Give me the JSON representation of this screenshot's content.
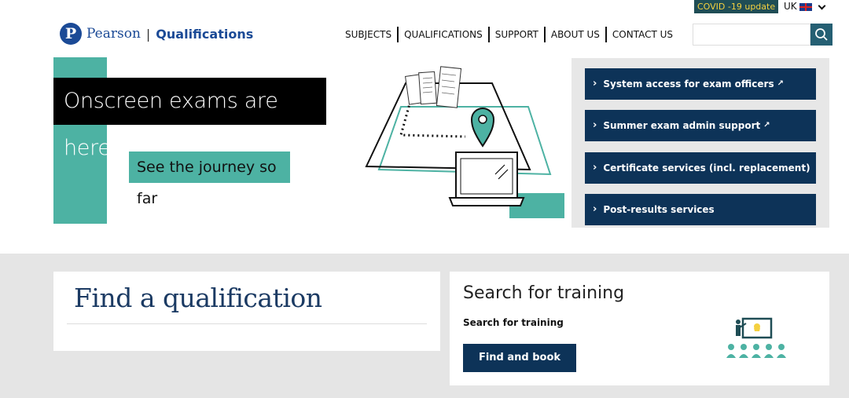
{
  "topbar": {
    "covid_label": "COVID -19 update",
    "locale_label": "UK"
  },
  "header": {
    "logo_brand": "Pearson",
    "logo_separator": "|",
    "logo_sub": "Qualifications",
    "nav": [
      "SUBJECTS",
      "QUALIFICATIONS",
      "SUPPORT",
      "ABOUT US",
      "CONTACT US"
    ],
    "search_placeholder": ""
  },
  "hero": {
    "title": "Onscreen exams are here...",
    "cta": "See the journey so far"
  },
  "quick_links": [
    {
      "label": "System access for exam officers",
      "external": true
    },
    {
      "label": "Summer exam admin support",
      "external": true
    },
    {
      "label": "Certificate services (incl. replacement)",
      "external": false
    },
    {
      "label": "Post-results services",
      "external": false
    }
  ],
  "find_card": {
    "title": "Find a qualification"
  },
  "training_card": {
    "title": "Search for training",
    "subtitle": "Search for training",
    "button": "Find and book"
  },
  "colors": {
    "teal": "#4db2a3",
    "navy": "#0d3358",
    "brand_blue": "#1b4a96",
    "covid_bg": "#1f4d55",
    "covid_text": "#f4d03f"
  }
}
